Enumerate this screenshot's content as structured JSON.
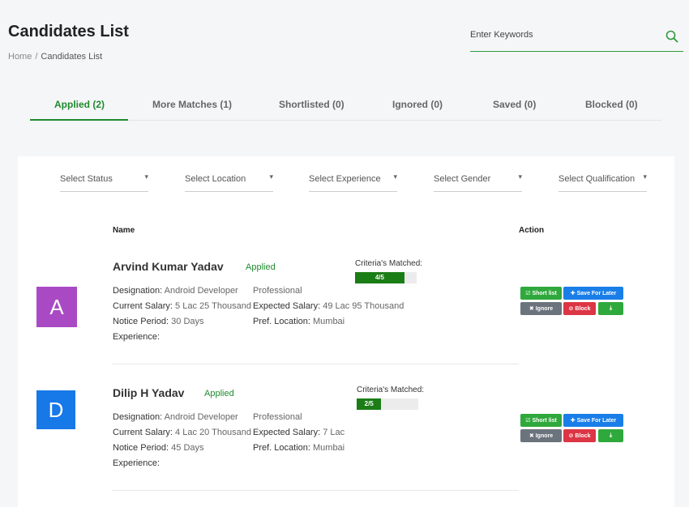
{
  "header": {
    "title": "Candidates List",
    "breadcrumb": {
      "home": "Home",
      "separator": "/",
      "current": "Candidates List"
    },
    "search_placeholder": "Enter Keywords",
    "search_icon": "search-icon"
  },
  "tabs": [
    {
      "label": "Applied (2)",
      "active": true
    },
    {
      "label": "More Matches (1)"
    },
    {
      "label": "Shortlisted (0)"
    },
    {
      "label": "Ignored (0)"
    },
    {
      "label": "Saved (0)"
    },
    {
      "label": "Blocked (0)"
    }
  ],
  "filters": [
    {
      "label": "Select Status"
    },
    {
      "label": "Select Location"
    },
    {
      "label": "Select Experience"
    },
    {
      "label": "Select Gender"
    },
    {
      "label": "Select Qualification"
    }
  ],
  "table": {
    "col_name": "Name",
    "col_action": "Action"
  },
  "actions": {
    "shortlist": "Short list",
    "save": "Save For Later",
    "ignore": "Ignore",
    "block": "Block"
  },
  "candidates": [
    {
      "initial": "A",
      "avatar_color": "#a94ac4",
      "name": "Arvind Kumar Yadav",
      "status": "Applied",
      "designation_label": "Designation:",
      "designation": "Android Developer",
      "current_salary_label": "Current Salary:",
      "current_salary": "5 Lac 25 Thousand",
      "notice_label": "Notice Period:",
      "notice": "30 Days",
      "experience_label": "Experience:",
      "type": "Professional",
      "expected_salary_label": "Expected Salary:",
      "expected_salary": "49 Lac 95 Thousand",
      "location_label": "Pref. Location:",
      "location": "Mumbai",
      "criteria_label": "Criteria's Matched:",
      "criteria_text": "4/5",
      "criteria_fraction": 0.8
    },
    {
      "initial": "D",
      "avatar_color": "#1778e8",
      "name": "Dilip H Yadav",
      "status": "Applied",
      "designation_label": "Designation:",
      "designation": "Android Developer",
      "current_salary_label": "Current Salary:",
      "current_salary": "4 Lac 20 Thousand",
      "notice_label": "Notice Period:",
      "notice": "45 Days",
      "experience_label": "Experience:",
      "type": "Professional",
      "expected_salary_label": "Expected Salary:",
      "expected_salary": "7 Lac",
      "location_label": "Pref. Location:",
      "location": "Mumbai",
      "criteria_label": "Criteria's Matched:",
      "criteria_text": "2/5",
      "criteria_fraction": 0.4
    }
  ],
  "colors": {
    "accent": "#1f8a2e",
    "primary": "#1a7ee8",
    "danger": "#dc3545",
    "muted": "#6b737d"
  }
}
